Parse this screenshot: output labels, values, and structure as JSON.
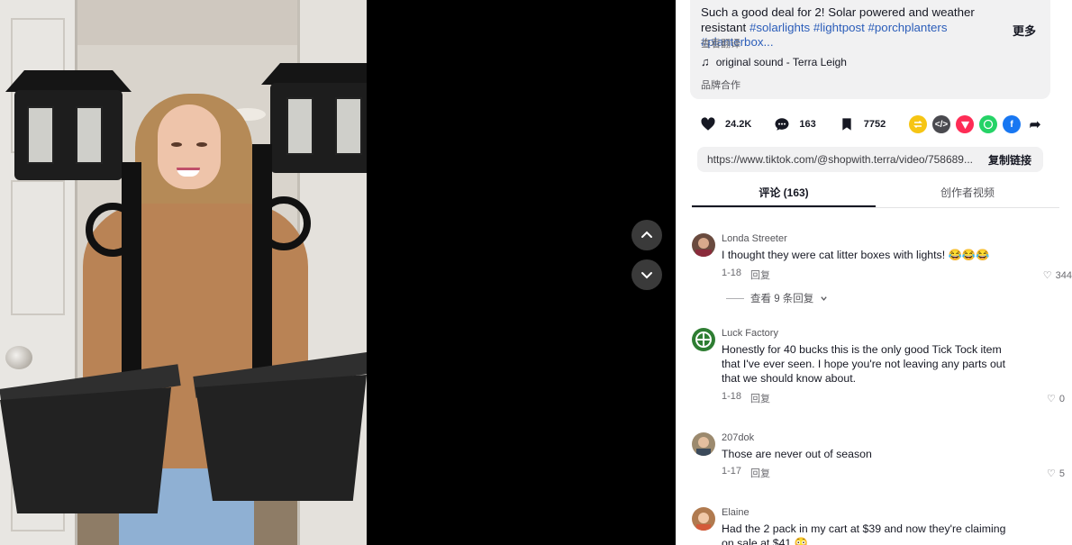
{
  "video": {
    "nav_prev_icon": "chevron-up-icon",
    "nav_next_icon": "chevron-down-icon"
  },
  "description": {
    "text": "Such a good deal for 2! Solar powered and weather resistant ",
    "hashtags": "#solarlights #lightpost #porchplanters #planterbox...",
    "more_label": "更多",
    "translate_label": "查看翻译",
    "sound": "original sound - Terra Leigh",
    "brand_tag": "品牌合作"
  },
  "actions": {
    "likes": "24.2K",
    "comments": "163",
    "saves": "7752"
  },
  "share_colors": {
    "repost": "#f6c514",
    "embed": "#4a4a4f",
    "send": "#fe2c55",
    "whatsapp": "#25d366",
    "facebook": "#1877f2"
  },
  "link": {
    "url": "https://www.tiktok.com/@shopwith.terra/video/758689...",
    "copy_label": "复制链接"
  },
  "tabs": {
    "comments": "评论 (163)",
    "creator_videos": "创作者视频"
  },
  "comments": [
    {
      "user": "Londa Streeter",
      "text": "I thought they were cat litter boxes with lights! 😂😂😂",
      "date": "1-18",
      "reply_label": "回复",
      "likes": "344",
      "view_replies": "查看 9 条回复"
    },
    {
      "user": "Luck Factory",
      "text": "Honestly for 40 bucks this is the only good Tick Tock item that I've ever seen. I hope you're not leaving any parts out that we should know about.",
      "date": "1-18",
      "reply_label": "回复",
      "likes": "0"
    },
    {
      "user": "207dok",
      "text": "Those are never out of season",
      "date": "1-17",
      "reply_label": "回复",
      "likes": "5"
    },
    {
      "user": "Elaine",
      "text": "Had the 2 pack in my cart at $39 and now they're claiming on sale at $41 😳",
      "date": "",
      "reply_label": "",
      "likes": ""
    }
  ]
}
